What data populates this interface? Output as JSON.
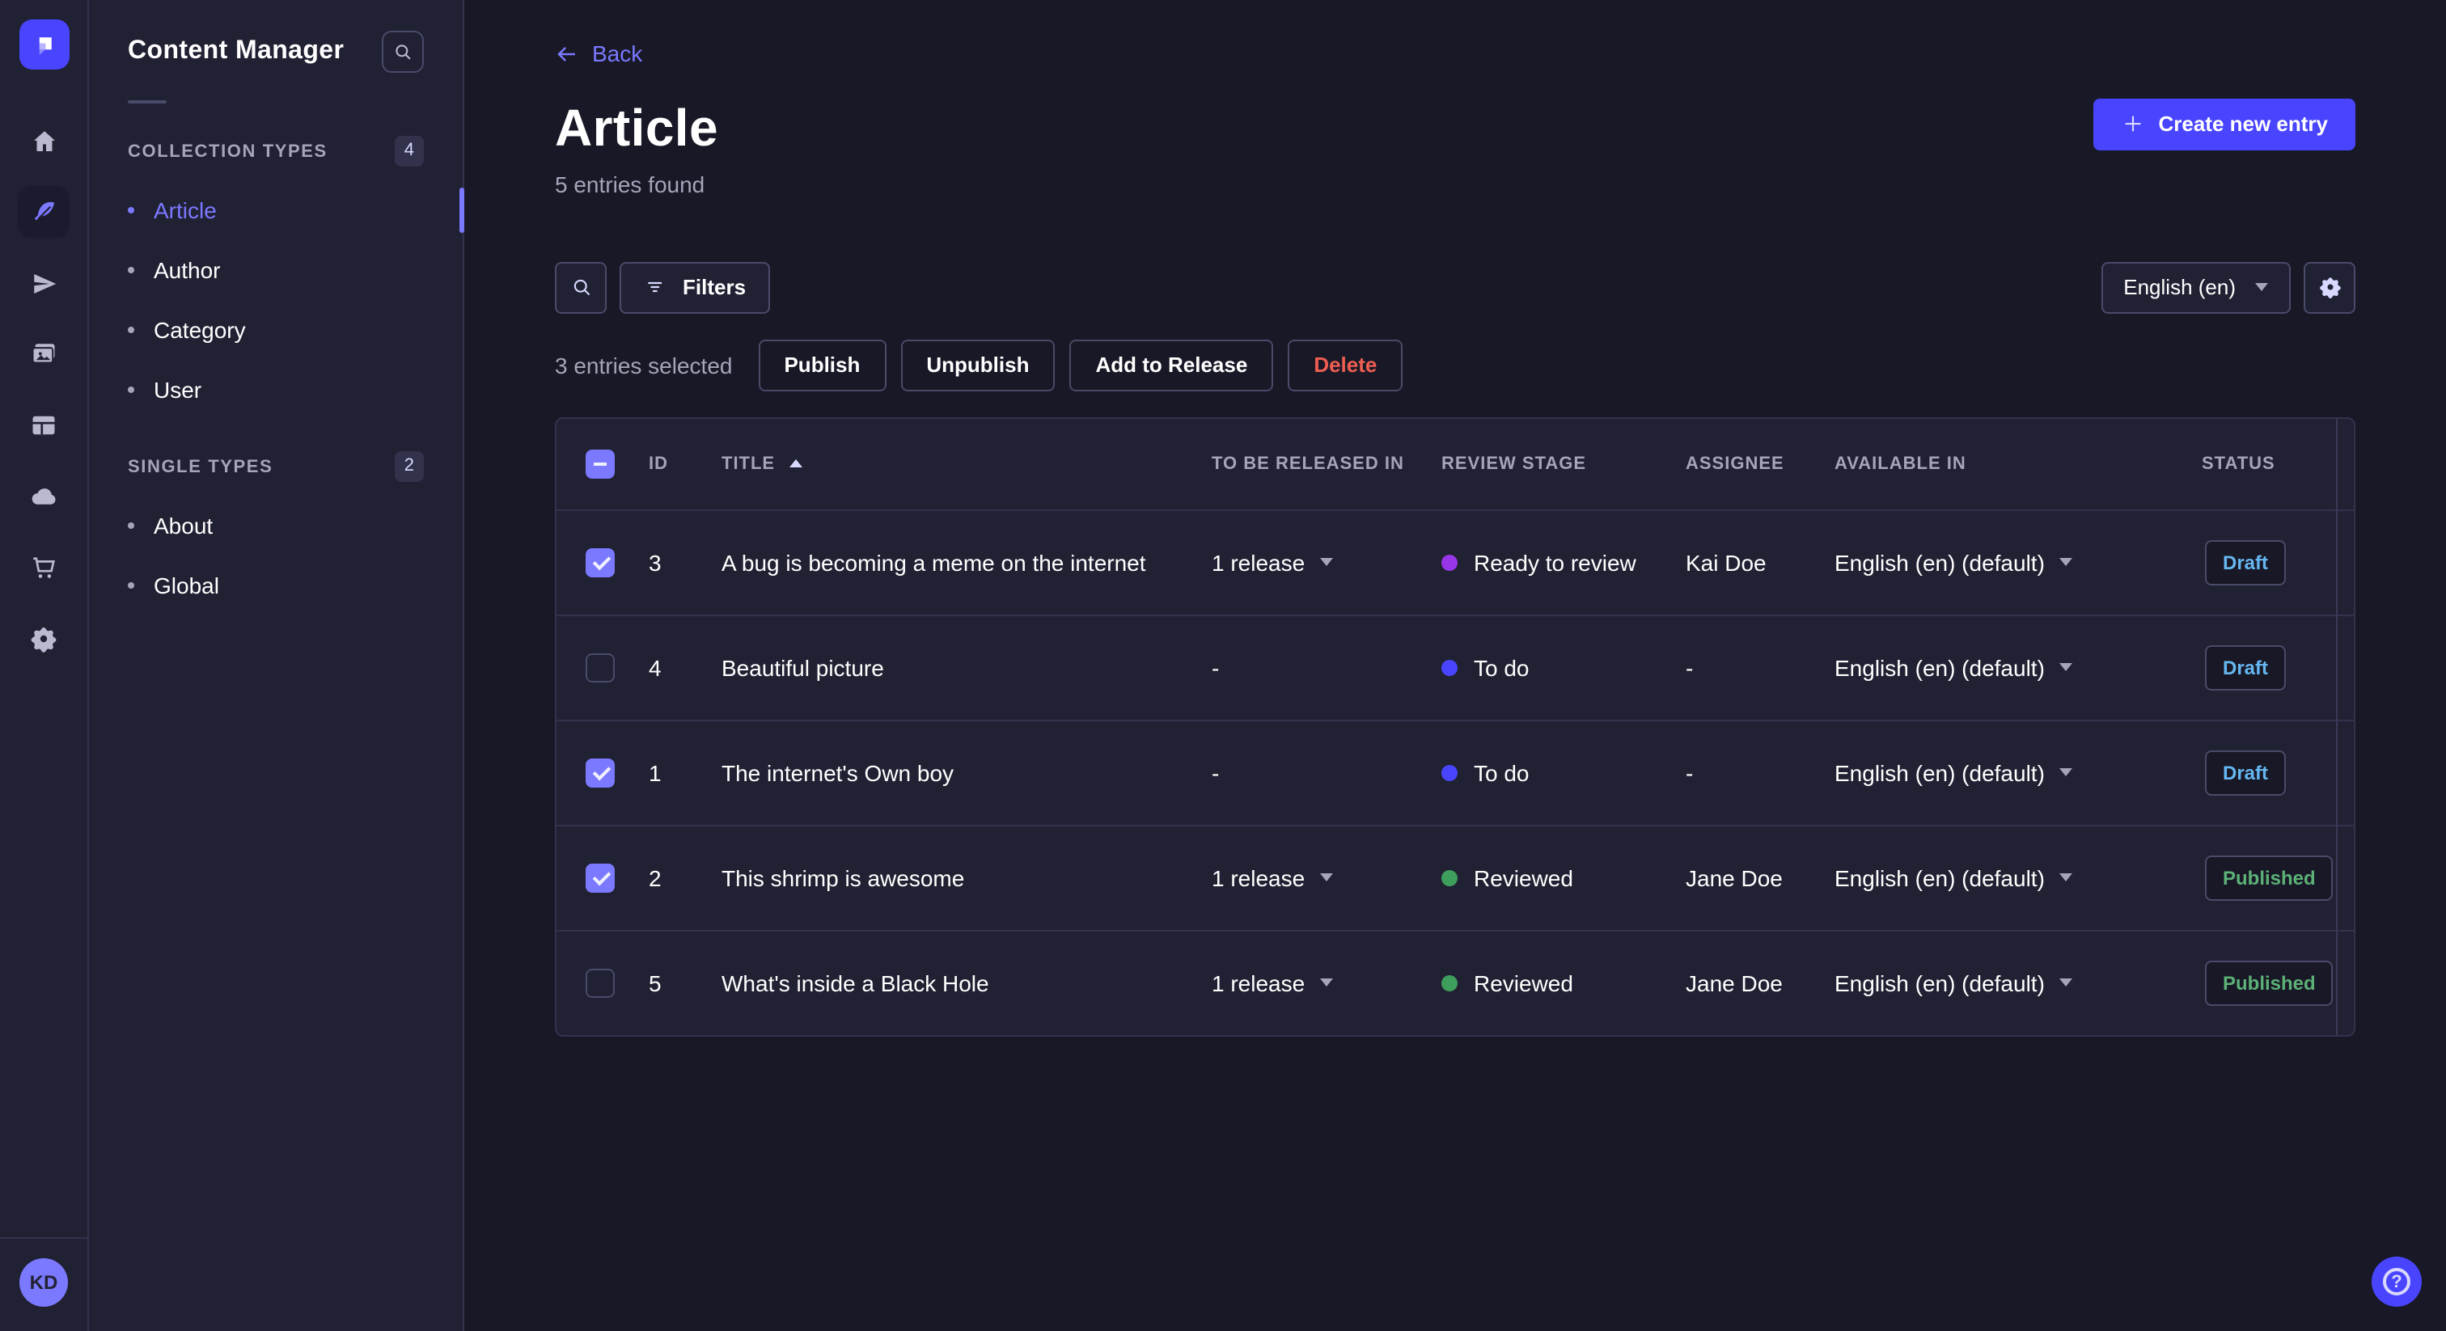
{
  "colors": {
    "primary": "#4945ff",
    "primary_light": "#7b79ff",
    "danger": "#ee5e52",
    "success_text": "#5cb176",
    "draft_text": "#66b7f1",
    "stage_ready_to_review": "#9736e8",
    "stage_to_do": "#4945ff",
    "stage_reviewed": "#3e9e5c"
  },
  "rail": {
    "logo": "strapi-logo",
    "items": [
      "home-icon",
      "content-manager-feather-icon",
      "releases-paper-plane-icon",
      "media-library-icon",
      "content-type-builder-icon",
      "deploy-cloud-icon",
      "marketplace-cart-icon",
      "settings-gear-icon"
    ],
    "user_initials": "KD"
  },
  "nav": {
    "title": "Content Manager",
    "sections": [
      {
        "label": "COLLECTION TYPES",
        "count": "4",
        "items": [
          {
            "label": "Article"
          },
          {
            "label": "Author"
          },
          {
            "label": "Category"
          },
          {
            "label": "User"
          }
        ]
      },
      {
        "label": "SINGLE TYPES",
        "count": "2",
        "items": [
          {
            "label": "About"
          },
          {
            "label": "Global"
          }
        ]
      }
    ]
  },
  "header": {
    "back_label": "Back",
    "title": "Article",
    "subtitle": "5 entries found",
    "create_button": "Create new entry"
  },
  "toolbar": {
    "filters_label": "Filters",
    "locale_selected": "English (en)"
  },
  "bulk": {
    "selected_text": "3 entries selected",
    "publish": "Publish",
    "unpublish": "Unpublish",
    "add_to_release": "Add to Release",
    "delete": "Delete"
  },
  "table": {
    "columns": [
      "ID",
      "TITLE",
      "TO BE RELEASED IN",
      "REVIEW STAGE",
      "ASSIGNEE",
      "AVAILABLE IN",
      "STATUS"
    ],
    "rows": [
      {
        "checked": true,
        "id": "3",
        "title": "A bug is becoming a meme on the internet",
        "released_in": "1 release",
        "review_stage": "Ready to review",
        "stage_color": "#9736e8",
        "assignee": "Kai Doe",
        "available_in": "English (en) (default)",
        "status": "Draft"
      },
      {
        "checked": false,
        "id": "4",
        "title": "Beautiful picture",
        "released_in": "-",
        "review_stage": "To do",
        "stage_color": "#4945ff",
        "assignee": "-",
        "available_in": "English (en) (default)",
        "status": "Draft"
      },
      {
        "checked": true,
        "id": "1",
        "title": "The internet's Own boy",
        "released_in": "-",
        "review_stage": "To do",
        "stage_color": "#4945ff",
        "assignee": "-",
        "available_in": "English (en) (default)",
        "status": "Draft"
      },
      {
        "checked": true,
        "id": "2",
        "title": "This shrimp is awesome",
        "released_in": "1 release",
        "review_stage": "Reviewed",
        "stage_color": "#3e9e5c",
        "assignee": "Jane Doe",
        "available_in": "English (en) (default)",
        "status": "Published"
      },
      {
        "checked": false,
        "id": "5",
        "title": "What's inside a Black Hole",
        "released_in": "1 release",
        "review_stage": "Reviewed",
        "stage_color": "#3e9e5c",
        "assignee": "Jane Doe",
        "available_in": "English (en) (default)",
        "status": "Published"
      }
    ]
  },
  "footer": {
    "help": "help-question-icon"
  }
}
